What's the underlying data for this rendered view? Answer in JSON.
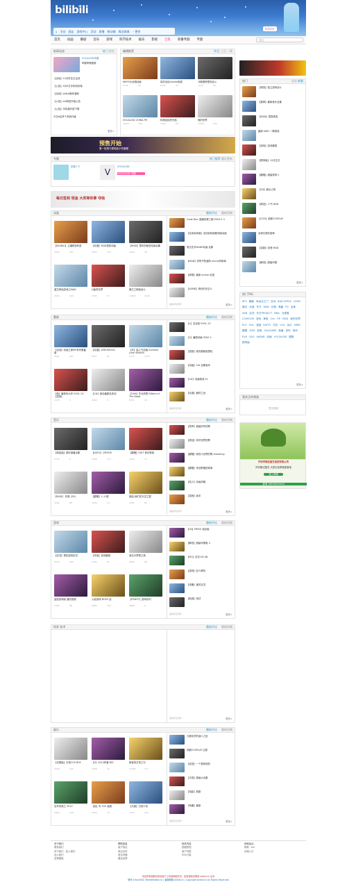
{
  "header": {
    "logo": "bilibili",
    "topnav": [
      "主站",
      "画友",
      "游戏中心",
      "活动",
      "直播",
      "移动端",
      "周边商城",
      "·· 更多"
    ],
    "star_btn": "bilistar"
  },
  "nav": {
    "items": [
      "首页",
      "动画",
      "番剧",
      "音乐",
      "游戏",
      "科学技术",
      "娱乐",
      "影视",
      "合集",
      "新番专题",
      "专题"
    ],
    "search_placeholder": "搜索"
  },
  "latest": {
    "title": "新闻动态",
    "tabs": [
      "热门",
      "综合"
    ],
    "headlines": [
      "VOCALOID中国",
      "哔哩哔哩视频"
    ],
    "lines": [
      "【活动】12月份生日企划",
      "【公告】4月5日手机网页端",
      "【活动】bilibili新年福利",
      "【公告】bili系统升级公告",
      "【公告】手机端开放下载",
      "今日b站多个系统升级"
    ],
    "more": "更多>"
  },
  "recommend": {
    "title": "编辑推荐",
    "tabs": [
      "昨日",
      "三日",
      "一周"
    ],
    "items": [
      {
        "cap": "MHP3大合唱动画",
        "stats": [
          "1754",
          "65"
        ]
      },
      {
        "cap": "探究全民Sonelo电视",
        "stats": [
          "6332",
          "36"
        ]
      },
      {
        "cap": "冲着剧情里的战斗",
        "stats": [
          "1975",
          "69"
        ]
      },
      {
        "cap": "VOCALOID CHINA PR",
        "stats": [
          "10977",
          "199"
        ]
      },
      {
        "cap": "机械战队的作品",
        "stats": [
          "1390",
          "69"
        ]
      },
      {
        "cap": "我的世界",
        "stats": [
          "13976",
          "160"
        ]
      }
    ]
  },
  "promo1": {
    "text": "预售开始",
    "sub": "第一批预订看电影小吃套餐"
  },
  "special": {
    "title": "专题",
    "tab": "热门推荐",
    "tab2": "最近更新",
    "name1": "初音ミク",
    "name2": "VOCALOID",
    "badge": "VOCALOID 中国"
  },
  "promo2": {
    "text": "每日签到 现金 大奖等你拿 夺绘"
  },
  "sections": [
    {
      "title": "动画",
      "tabs": [
        "最新评论",
        "最新投稿"
      ],
      "items": [
        {
          "cap": "【BILIBILI】主播精选有奖",
          "stats": [
            "1990",
            "181"
          ]
        },
        {
          "cap": "【动漫】MAD混剪动画",
          "stats": [
            "1553",
            "145"
          ]
        },
        {
          "cap": "【MAD】童年的秘密动画合集",
          "stats": [
            "1980",
            "38"
          ]
        },
        {
          "cap": "重生神话游戏之MAD",
          "stats": [
            "3992",
            "180"
          ]
        },
        {
          "cap": "Q版虎花梦",
          "stats": [
            "1953",
            "72"
          ]
        },
        {
          "cap": "魔王之家版战斗",
          "stats": [
            "14623",
            "1990"
          ]
        }
      ],
      "side": [
        "Code Disc 直播的第三期 STAG E 3",
        "【名侦探柯南】名侦探柯南剧场版动画",
        "英文花字MADE动画 合集",
        "【MAD】你所不知道的 anime的故事",
        "【转载】最新 anime 动漫",
        "【ASMR】奇妙的天空人"
      ],
      "side_meta": "最新评论同步",
      "more": "更多>"
    },
    {
      "title": "番剧",
      "tabs": [
        "最新评论",
        "最新投稿"
      ],
      "items": [
        {
          "cap": "【活动】动画之家MV系列鬼畜版",
          "stats": [
            "3641",
            "181"
          ]
        },
        {
          "cap": "【动漫】ZEROMUSIC",
          "stats": [
            "9811",
            "85"
          ]
        },
        {
          "cap": "【天】高人气动画 Summer Love SINGER",
          "stats": [
            "1970",
            "1233"
          ]
        },
        {
          "cap": "【转】最新的大作 EVOL 23 【混音】",
          "stats": [
            "1478",
            "0"
          ]
        },
        {
          "cap": "【1#】极佳番剧名改动",
          "stats": [
            "4000",
            "6"
          ]
        },
        {
          "cap": "【OVA】毕业的歌 Rifters of The Dead",
          "stats": [
            "6953",
            "40"
          ]
        }
      ],
      "side": [
        "【1】名侦探 EVOL 23",
        "【1】番剧动画 STAG 2",
        "【混音】我的超新星冒险",
        "【动画】3rd 合集版本",
        "【1#】动画精选 SC",
        "【动漫】最终之战"
      ],
      "side_meta": "最新评论同步",
      "more": "更多>"
    },
    {
      "title": "音乐",
      "tabs": [
        "最新评论",
        "最新投稿"
      ],
      "items": [
        {
          "cap": "【奇迹曲】精彩演奏合集",
          "stats": [
            "1043",
            "9"
          ]
        },
        {
          "cap": "【KATO】-ERROR",
          "stats": [
            "1098",
            "113"
          ]
        },
        {
          "cap": "【翻唱】EDIT 音乐歌姬",
          "stats": [
            "1009",
            "13"
          ]
        },
        {
          "cap": "【MAD】 初音 (2D)",
          "stats": [
            "3000",
            "88"
          ]
        },
        {
          "cap": "【翻唱】1-11首",
          "stats": [
            "1890",
            "14"
          ]
        },
        {
          "cap": "新曲-我们在天空之翼",
          "stats": [
            "1562",
            "84"
          ]
        }
      ],
      "side": [
        "【男声】超级好听的歌",
        "【原创】你好世界的歌",
        "【翻唱】我的小世界的歌 dreaming",
        "【翻唱】来自歌唱的故事",
        "【双人】动画风格",
        "【混音】版本"
      ],
      "side_meta": "最新评论同步",
      "more": "更多>"
    },
    {
      "title": "游戏",
      "tabs": [
        "最新评论",
        "最新投稿"
      ],
      "items": [
        {
          "cap": "【实况】冒险游戏实况",
          "stats": [
            "5530",
            "195"
          ]
        },
        {
          "cap": "【作品】游戏集锦",
          "stats": [
            "1345",
            "53"
          ]
        },
        {
          "cap": "宝石与梦想之旅",
          "stats": [
            "6955",
            "88"
          ]
        },
        {
          "cap": "迷宫游戏版 通关视频",
          "stats": [
            "2465",
            "88"
          ]
        },
        {
          "cap": "火影游戏 BOSS 战",
          "stats": [
            "6985",
            "193"
          ]
        },
        {
          "cap": "【PSBOT】游戏系列",
          "stats": [
            "4888",
            "0"
          ]
        }
      ],
      "side": [
        "【LB】MHSG 组合版",
        "【解说】超级玛丽奥 3",
        "【MC】实况 EN 4N",
        "【游戏】四人联机",
        "【攻略】通关实况",
        "【新游】测试"
      ],
      "side_meta": "最新评论同步",
      "more": "更多>"
    },
    {
      "title": "科学·技术",
      "tabs": [
        "最新评论",
        "最新投稿"
      ],
      "items": [],
      "side": [],
      "side_meta": "最新评论同步",
      "more": "更多>"
    },
    {
      "title": "娱乐",
      "tabs": [
        "最新评论",
        "最新投稿"
      ],
      "items": [
        {
          "cap": "【无限版】日常COS BOY",
          "stats": [
            "3040",
            "121"
          ]
        },
        {
          "cap": "【V】2010年春 BIG",
          "stats": [
            "1906",
            "15"
          ]
        },
        {
          "cap": "宿舍的日常之行",
          "stats": [
            "11605",
            "117"
          ]
        },
        {
          "cap": "合作宅妹之 2012",
          "stats": [
            "1863",
            "118"
          ]
        },
        {
          "cap": "【影】年 433 喜剧",
          "stats": [
            "1890",
            "79"
          ]
        },
        {
          "cap": "【元素】日常小宅",
          "stats": [
            "1303",
            "200"
          ]
        }
      ],
      "side": [
        "元素化学的迷人之处",
        "成都COSPLAY 比赛",
        "【说说】一个很特别的",
        "【日常】超级大合集",
        "【电影】新剧",
        "【有趣】最新"
      ],
      "side_meta": "最新评论同步",
      "more": "更多>"
    }
  ],
  "hotlist": {
    "tabs": [
      "热门",
      "全站",
      "新番"
    ],
    "items": [
      "【原创】独立游戏战斗",
      "【推荐】最新音乐合集",
      "【MAD】混剪精选",
      "最新 MAD 一周精选",
      "【游戏】游戏集锦",
      "【剧场版】12月生日",
      "【翻唱】超级现场 2",
      "【2D】魔女之夜",
      "【原创】人气 MAD",
      "【COS】成都COSPLAY",
      "全球日常的各种",
      "【自制】初音 MAD",
      "【解说】超级玛丽"
    ],
    "more": "更多>"
  },
  "tags": {
    "title": "热门TAG",
    "list": [
      "BF3",
      "舞蹈",
      "命运石之门",
      "亚洲",
      "BAD APPLE",
      "GUMI",
      "魔法",
      "动漫",
      "东方",
      "MAD",
      "初音",
      "鬼畜",
      "PV",
      "龙珠",
      "AKB",
      "实况",
      "东方PROJECT",
      "BNA",
      "马里奥",
      "LOVELIVE",
      "游戏",
      "美食",
      "2ch",
      "OP",
      "MAD",
      "我的世界",
      "ELS",
      "GGL",
      "漫画",
      "KAITO",
      "汉化",
      "LOU",
      "战斗",
      "MMD",
      "翻唱",
      "SGM",
      "探索",
      "GALGAME",
      "新番",
      "变形",
      "哈利",
      "EVA",
      "SAO",
      "AKB48",
      "动画",
      "VOCALOID",
      "舰娘",
      "剧场版"
    ],
    "more": "更多>"
  },
  "follow": {
    "title": "我关注的频道",
    "empty": "暂无频道"
  },
  "ad": {
    "company": "开封市锦达园艺造型有限公司",
    "sub": "开封锦达园艺 大型五色草造型基地",
    "phone": "咨询 18538293440",
    "btn": "进入商城"
  },
  "footer": {
    "cols": [
      {
        "h": "关于我们",
        "lines": [
          "联系我们",
          "关于我们 · 加入我们",
          "加入我们",
          "友情链接"
        ]
      },
      {
        "h": "帮助信息",
        "lines": [
          "用户协议",
          "商业合作",
          "常见问题",
          "建议反馈"
        ]
      },
      {
        "h": "相关内容",
        "lines": [
          "投稿须知",
          "用户列表",
          "RSS订阅"
        ]
      },
      {
        "h": "其他站点",
        "lines": [
          "阿斯 · bili",
          "动漫入口"
        ]
      }
    ],
    "copy1": "本站所有视频均来自用户上传或网络共享，如有侵权请联系 bilibili.tv 站长",
    "copy2": "联系 Email BGS Tellet@bilibili.tv | 客服邮箱 bilibili.tv | Copyright bilibili.tv All Rights Reserved"
  }
}
